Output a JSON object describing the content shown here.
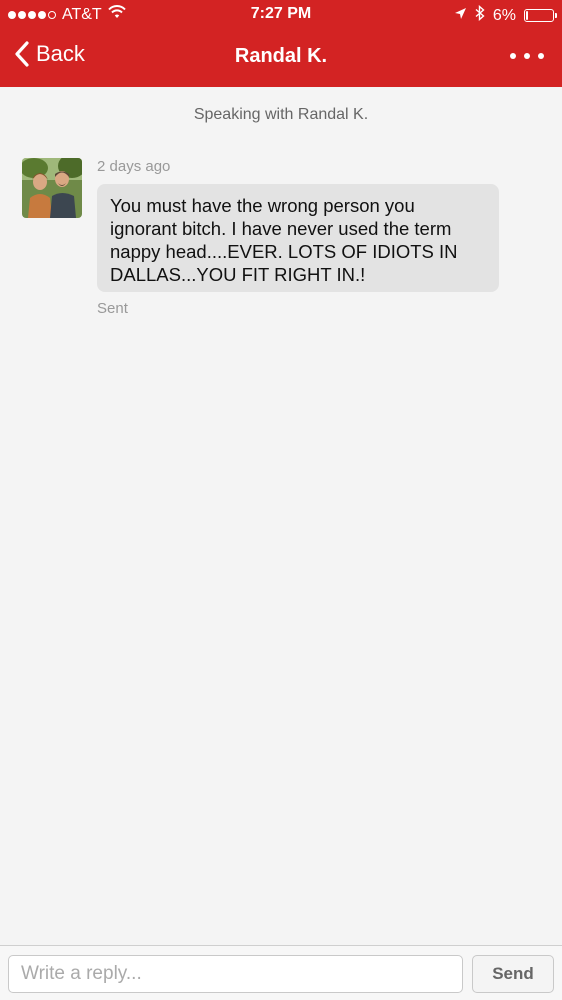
{
  "status_bar": {
    "carrier": "AT&T",
    "time": "7:27 PM",
    "battery": "6%",
    "battery_level": 0.06,
    "signal_bars_filled": 4,
    "signal_bars_total": 5
  },
  "nav": {
    "back_label": "Back",
    "title": "Randal K."
  },
  "conversation": {
    "speaking_with": "Speaking with Randal K.",
    "message": {
      "timestamp": "2 days ago",
      "text": "You must have the wrong person you ignorant bitch.  I have never used the term nappy head....EVER.  LOTS OF IDIOTS IN DALLAS...YOU FIT RIGHT IN.!",
      "lines": [
        "You must have the wrong person you",
        "ignorant bitch.  I have never used the term",
        "nappy head....EVER.  LOTS OF IDIOTS IN",
        "DALLAS...YOU FIT RIGHT IN.!"
      ],
      "status": "Sent"
    }
  },
  "composer": {
    "placeholder": "Write a reply...",
    "send_label": "Send"
  },
  "colors": {
    "brand": "#d32323",
    "background": "#f4f4f4",
    "bubble": "#e3e3e3"
  },
  "icons": [
    "signal-icon",
    "wifi-icon",
    "location-arrow-icon",
    "bluetooth-icon",
    "battery-icon",
    "back-chevron-icon",
    "more-icon"
  ]
}
